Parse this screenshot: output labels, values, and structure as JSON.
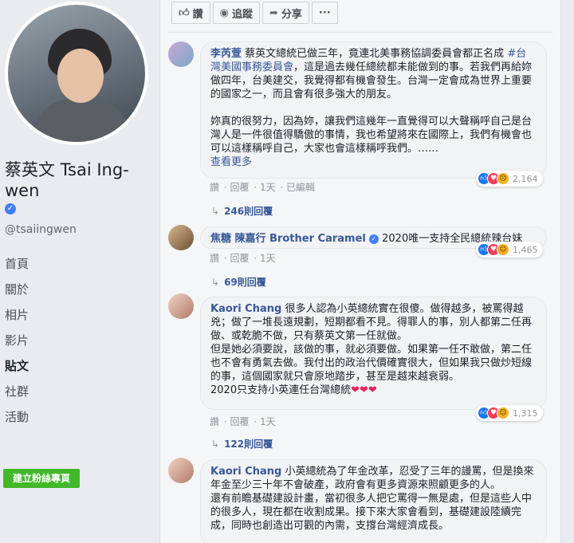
{
  "page": {
    "name": "蔡英文 Tsai Ing-wen",
    "handle": "@tsaiingwen",
    "nav": [
      "首頁",
      "關於",
      "相片",
      "影片",
      "貼文",
      "社群",
      "活動"
    ],
    "active_nav": "貼文",
    "fan_button": "建立粉絲專頁"
  },
  "actions": {
    "like": "讚",
    "follow": "追蹤",
    "share": "分享",
    "more": "···"
  },
  "comments": [
    {
      "author": "李芮萱",
      "text_1": "蔡英文總統已做三年，竟連北美事務協調委員會都正名成",
      "tag": "#台灣美國事務委員會",
      "text_2": "，這是過去幾任總統都未能做到的事。若我們再給妳做四年，台美建交，我覺得都有機會發生。台灣一定會成為世界上重要的國家之一，而且會有很多強大的朋友。",
      "text_3": "妳真的很努力，因為妳，讓我們這幾年一直覺得可以大聲稱呼自己是台灣人是一件很值得驕傲的事情，我也希望將來在國際上，我們有機會也可以這樣稱呼自己，大家也會這樣稱呼我們。……",
      "see_more": "查看更多",
      "meta": [
        "讚",
        "回覆",
        "1天",
        "已編輯"
      ],
      "reaction_count": "2,164",
      "replies": "246則回覆"
    },
    {
      "author": "焦糖 陳嘉行 Brother Caramel",
      "text_1": "2020唯一支持全民總統辣台妹",
      "meta": [
        "讚",
        "回覆",
        "1天"
      ],
      "reaction_count": "1,465",
      "replies": "69則回覆"
    },
    {
      "author": "Kaori Chang",
      "text_1": "很多人認為小英總統實在很傻。做得越多，被罵得越兇；做了一堆長遠規劃，短期都看不見。得罪人的事，別人都第二任再做、或乾脆不做，只有蔡英文第一任就做。",
      "text_2": "但是她必須要說，該做的事，就必須要做。如果第一任不敢做，第二任也不會有勇氣去做。我付出的政治代價確實很大，但如果我只做炒短線的事，這個國家就只會原地踏步，甚至是越來越衰弱。",
      "text_3": "2020只支持小英連任台灣總統",
      "hearts": "❤❤❤",
      "meta": [
        "讚",
        "回覆",
        "1天"
      ],
      "reaction_count": "1,315",
      "replies": "122則回覆"
    },
    {
      "author": "Kaori Chang",
      "text_1": "小英總統為了年金改革，忍受了三年的謾罵，但是換來年金至少三十年不會破產，政府會有更多資源來照顧更多的人。",
      "text_2": "還有前瞻基礎建設計畫，當初很多人把它罵得一無是處，但是這些人中的很多人，現在都在收割成果。接下來大家會看到，基礎建設陸續完成，同時也創造出可觀的內需，支撐台灣經濟成長。"
    }
  ],
  "colors": {
    "link": "#385898",
    "verified": "#4080ff",
    "fan_button": "#42b72a"
  }
}
